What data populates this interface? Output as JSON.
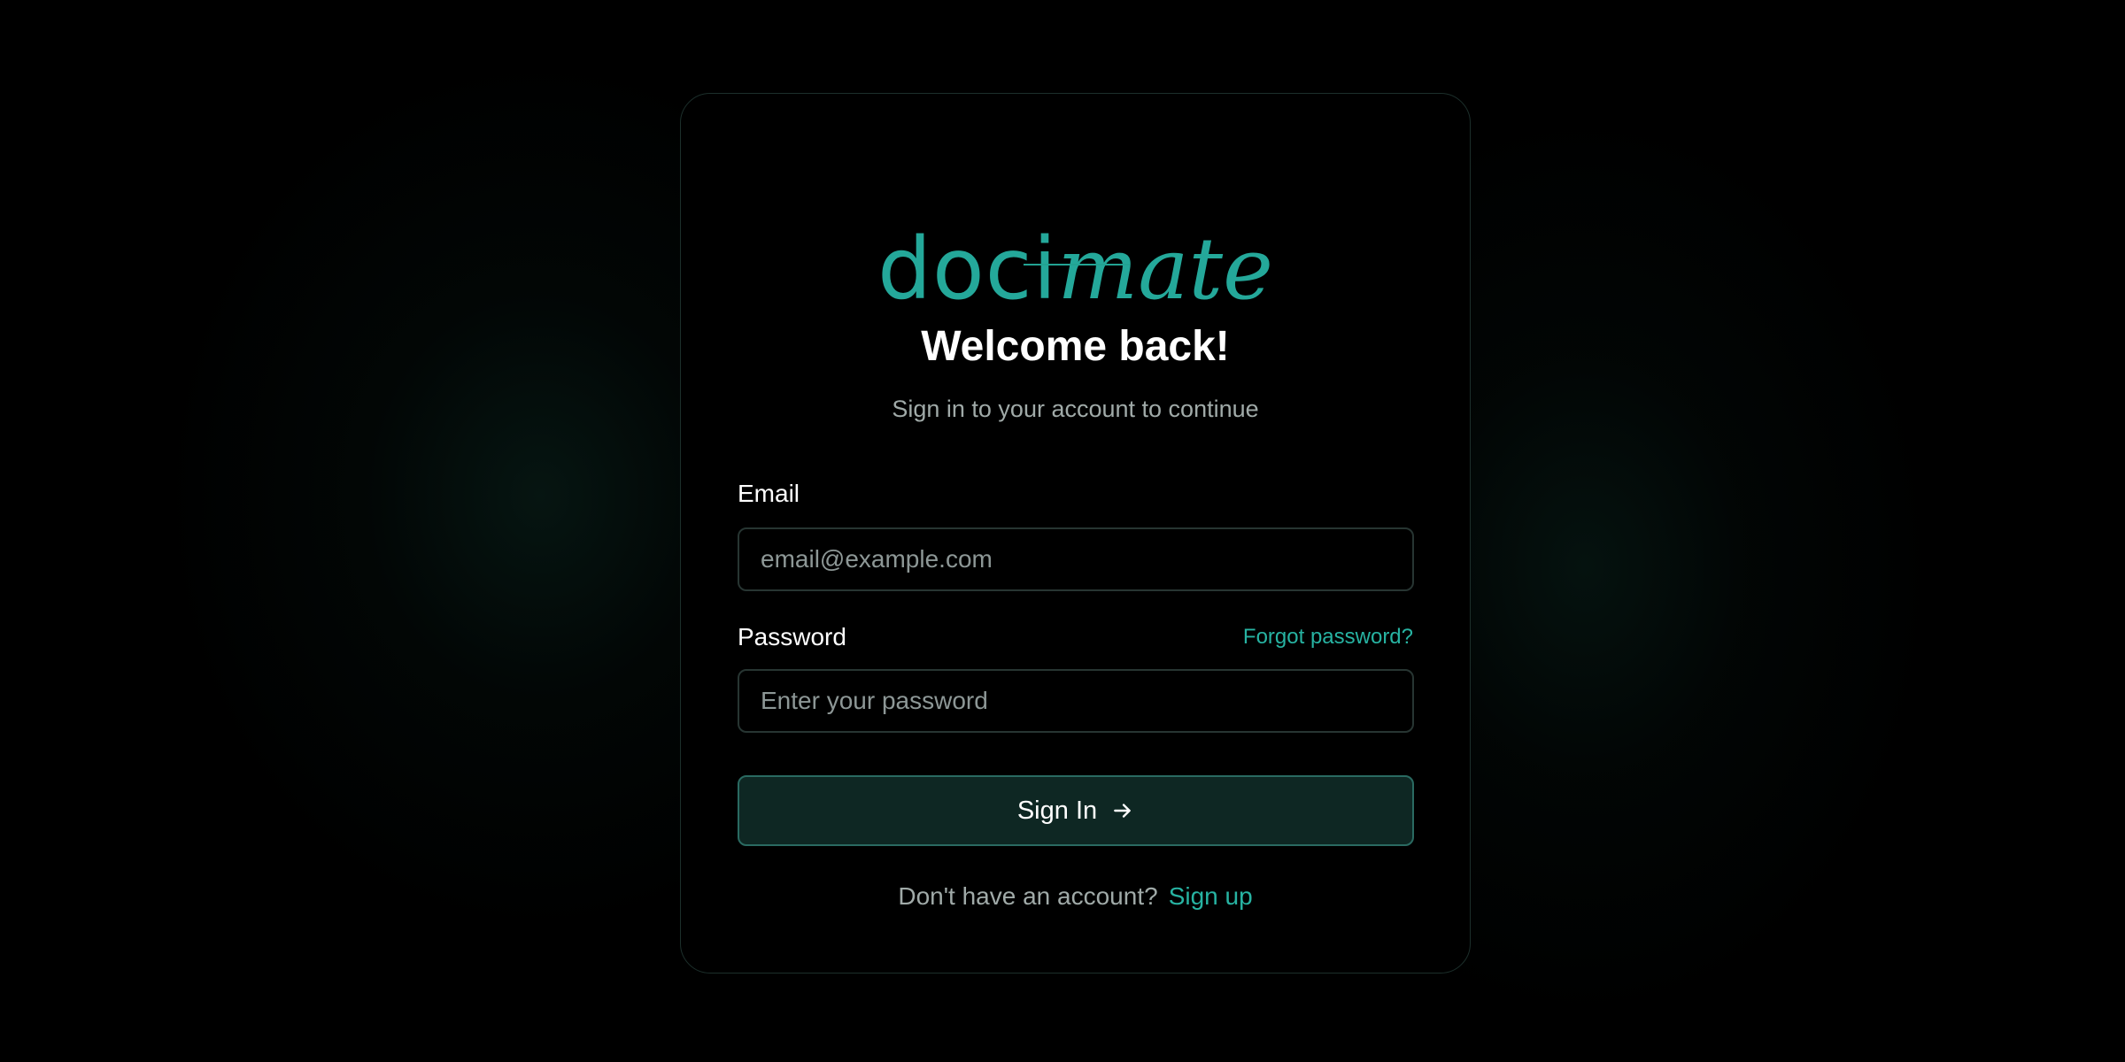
{
  "brand": {
    "logo_part1": "doci",
    "logo_part2": "mate",
    "accent_color": "#24a89a"
  },
  "header": {
    "title": "Welcome back!",
    "subtitle": "Sign in to your account to continue"
  },
  "form": {
    "email": {
      "label": "Email",
      "placeholder": "email@example.com",
      "value": ""
    },
    "password": {
      "label": "Password",
      "placeholder": "Enter your password",
      "value": "",
      "forgot_link": "Forgot password?"
    },
    "submit": {
      "label": "Sign In",
      "icon": "arrow-right-icon"
    }
  },
  "footer": {
    "prompt": "Don't have an account?",
    "signup_link": "Sign up"
  }
}
